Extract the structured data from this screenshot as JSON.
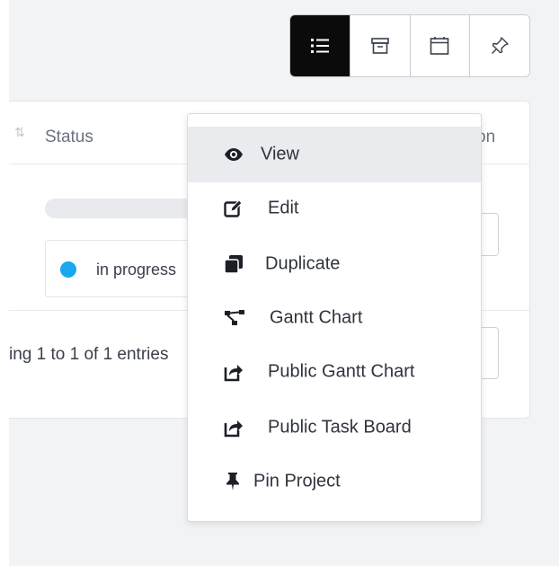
{
  "view_toggle": {
    "buttons": [
      {
        "icon": "list-icon",
        "active": true
      },
      {
        "icon": "archive-icon",
        "active": false
      },
      {
        "icon": "calendar-icon",
        "active": false
      },
      {
        "icon": "pin-icon",
        "active": false
      }
    ]
  },
  "table": {
    "headers": {
      "status": "Status",
      "action_partial": "on"
    },
    "rows": [
      {
        "status": "in progress",
        "progress_percent": 0
      }
    ],
    "footer": {
      "entries": "ing 1 to 1 of 1 entries"
    }
  },
  "menu": {
    "items": [
      {
        "label": "View",
        "icon": "eye-icon",
        "highlighted": true
      },
      {
        "label": "Edit",
        "icon": "edit-icon",
        "highlighted": false
      },
      {
        "label": "Duplicate",
        "icon": "duplicate-icon",
        "highlighted": false
      },
      {
        "label": "Gantt Chart",
        "icon": "gantt-icon",
        "highlighted": false
      },
      {
        "label": "Public Gantt Chart",
        "icon": "share-icon",
        "highlighted": false
      },
      {
        "label": "Public Task Board",
        "icon": "share-icon",
        "highlighted": false
      },
      {
        "label": "Pin Project",
        "icon": "thumbtack-icon",
        "highlighted": false
      }
    ]
  },
  "colors": {
    "accent_dark": "#0b0b0b",
    "status_in_progress": "#1aa7ee",
    "menu_highlight": "#e9ebee"
  }
}
